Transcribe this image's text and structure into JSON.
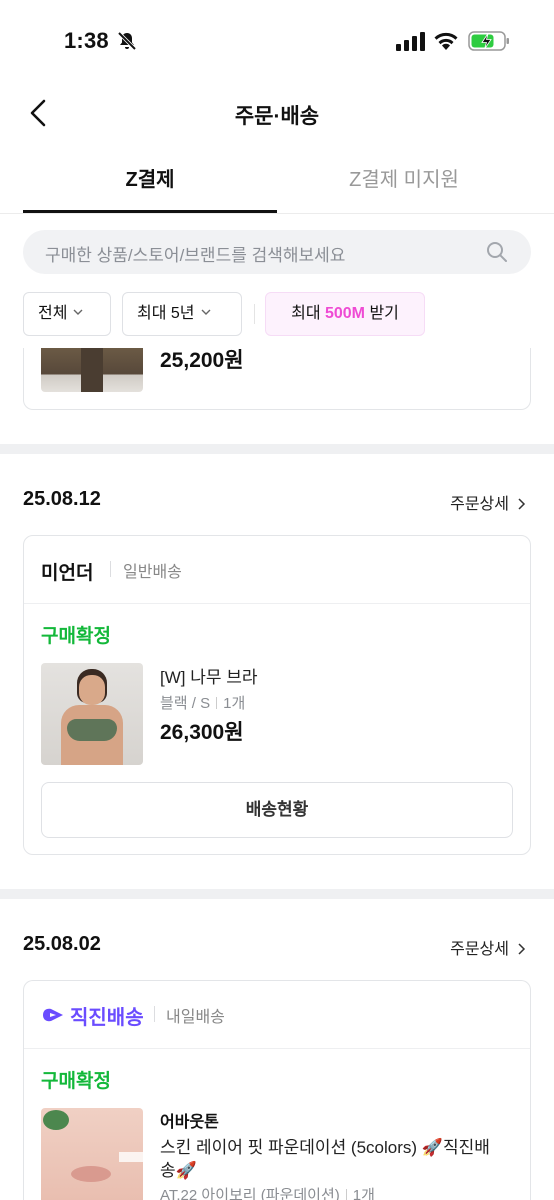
{
  "status_bar": {
    "time": "1:38"
  },
  "nav": {
    "title": "주문·배송"
  },
  "tabs": [
    {
      "label": "Z결제",
      "active": true
    },
    {
      "label": "Z결제 미지원",
      "active": false
    }
  ],
  "search": {
    "placeholder": "구매한 상품/스토어/브랜드를 검색해보세요"
  },
  "filters": {
    "all_label": "전체",
    "period_label": "최대 5년",
    "promo_prefix": "최대 ",
    "promo_accent": "500M",
    "promo_suffix": " 받기"
  },
  "partial_order": {
    "price": "25,200원"
  },
  "orders": [
    {
      "date": "25.08.12",
      "detail_label": "주문상세",
      "store": "미언더",
      "shipping": "일반배송",
      "status": "구매확정",
      "product_name": "[W] 나무 브라",
      "option": "블랙 / S",
      "quantity": "1개",
      "price": "26,300원",
      "track_button": "배송현황"
    },
    {
      "date": "25.08.02",
      "detail_label": "주문상세",
      "store": "직진배송",
      "shipping": "내일배송",
      "status": "구매확정",
      "brand": "어바웃톤",
      "product_name_line1": "스킨 레이어 핏 파운데이션 (5colors) 🚀직진배",
      "product_name_line2": "송🚀",
      "option": "AT.22 아이보리 (파운데이션)",
      "quantity": "1개"
    }
  ],
  "colors": {
    "accent_green": "#13b83a",
    "promo_pink": "#ef4bd4",
    "zigzag_purple": "#6a4cff",
    "battery_green": "#2ecc40"
  }
}
